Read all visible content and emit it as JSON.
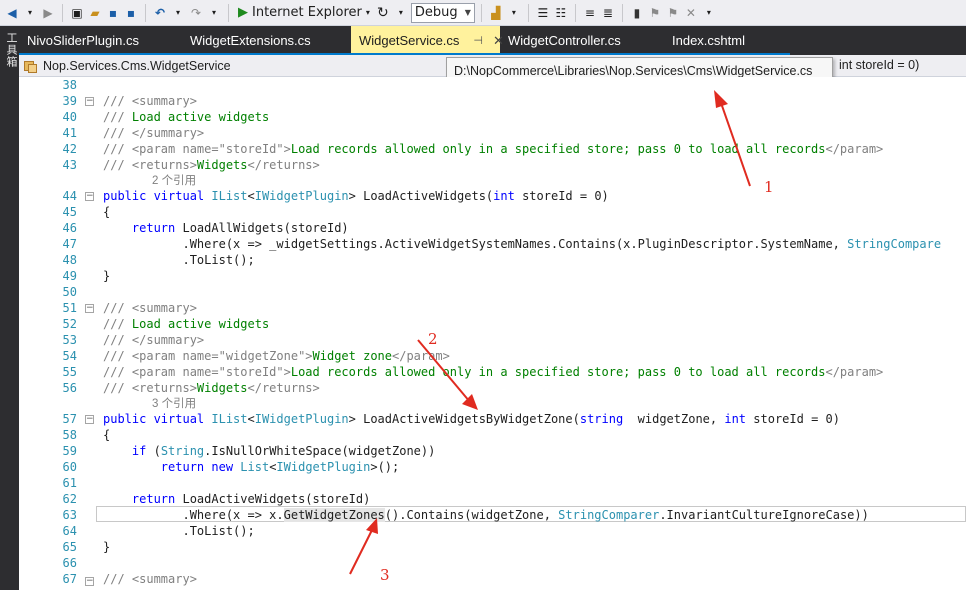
{
  "toolbar": {
    "run_target": "Internet Explorer",
    "config": "Debug"
  },
  "toolbox": {
    "label": "工具箱"
  },
  "tabs": [
    {
      "label": "NivoSliderPlugin.cs",
      "active": false
    },
    {
      "label": "WidgetExtensions.cs",
      "active": false
    },
    {
      "label": "WidgetService.cs",
      "active": true
    },
    {
      "label": "WidgetController.cs",
      "active": false
    },
    {
      "label": "Index.cshtml",
      "active": false
    }
  ],
  "nav": {
    "class_combo": "Nop.Services.Cms.WidgetService",
    "member_combo_tail": "int storeId = 0)"
  },
  "tooltip": {
    "path": "D:\\NopCommerce\\Libraries\\Nop.Services\\Cms\\WidgetService.cs"
  },
  "codelens": {
    "refs_2": "2 个引用",
    "refs_3": "3 个引用"
  },
  "annotations": {
    "one": "1",
    "two": "2",
    "three": "3"
  },
  "lines": [
    {
      "n": "38"
    },
    {
      "n": "39"
    },
    {
      "n": "40"
    },
    {
      "n": "41"
    },
    {
      "n": "42"
    },
    {
      "n": "43"
    },
    {
      "n": "44"
    },
    {
      "n": "45"
    },
    {
      "n": "46"
    },
    {
      "n": "47"
    },
    {
      "n": "48"
    },
    {
      "n": "49"
    },
    {
      "n": "50"
    },
    {
      "n": "51"
    },
    {
      "n": "52"
    },
    {
      "n": "53"
    },
    {
      "n": "54"
    },
    {
      "n": "55"
    },
    {
      "n": "56"
    },
    {
      "n": "57"
    },
    {
      "n": "58"
    },
    {
      "n": "59"
    },
    {
      "n": "60"
    },
    {
      "n": "61"
    },
    {
      "n": "62"
    },
    {
      "n": "63"
    },
    {
      "n": "64"
    },
    {
      "n": "65"
    },
    {
      "n": "66"
    },
    {
      "n": "67"
    }
  ],
  "code": {
    "l39": "/// <summary>",
    "l40a": "/// ",
    "l40b": "Load active widgets",
    "l41": "/// </summary>",
    "l42a": "/// <param name=\"storeId\">",
    "l42b": "Load records allowed only in a specified store; pass 0 to load all records",
    "l42c": "</param>",
    "l43a": "/// <returns>",
    "l43b": "Widgets",
    "l43c": "</returns>",
    "l44a": "public virtual ",
    "l44b": "IList",
    "l44c": "<",
    "l44d": "IWidgetPlugin",
    "l44e": "> LoadActiveWidgets(",
    "l44f": "int",
    "l44g": " storeId = 0)",
    "l45": "{",
    "l46a": "    return",
    "l46b": " LoadAllWidgets(storeId)",
    "l47a": "           .Where(x => _widgetSettings.ActiveWidgetSystemNames.Contains(x.PluginDescriptor.SystemName, ",
    "l47b": "StringCompare",
    "l48": "           .ToList();",
    "l49": "}",
    "l51": "/// <summary>",
    "l52a": "/// ",
    "l52b": "Load active widgets",
    "l53": "/// </summary>",
    "l54a": "/// <param name=\"widgetZone\">",
    "l54b": "Widget zone",
    "l54c": "</param>",
    "l55a": "/// <param name=\"storeId\">",
    "l55b": "Load records allowed only in a specified store; pass 0 to load all records",
    "l55c": "</param>",
    "l56a": "/// <returns>",
    "l56b": "Widgets",
    "l56c": "</returns>",
    "l57a": "public virtual ",
    "l57b": "IList",
    "l57c": "<",
    "l57d": "IWidgetPlugin",
    "l57e": "> LoadActiveWidgetsByWidgetZone(",
    "l57f": "string",
    "l57g": "  widgetZone, ",
    "l57h": "int",
    "l57i": " storeId = 0)",
    "l58": "{",
    "l59a": "    if",
    "l59b": " (",
    "l59c": "String",
    "l59d": ".IsNullOrWhiteSpace(widgetZone))",
    "l60a": "        return new",
    "l60b": " ",
    "l60c": "List",
    "l60d": "<",
    "l60e": "IWidgetPlugin",
    "l60f": ">();",
    "l62a": "    return",
    "l62b": " LoadActiveWidgets(storeId)",
    "l63a": "           .Where(x => x.",
    "l63b": "GetWidgetZones",
    "l63c": "().Contains(widgetZone, ",
    "l63d": "StringComparer",
    "l63e": ".InvariantCultureIgnoreCase))",
    "l64": "           .ToList();",
    "l65": "}",
    "l67": "/// <summary>"
  }
}
